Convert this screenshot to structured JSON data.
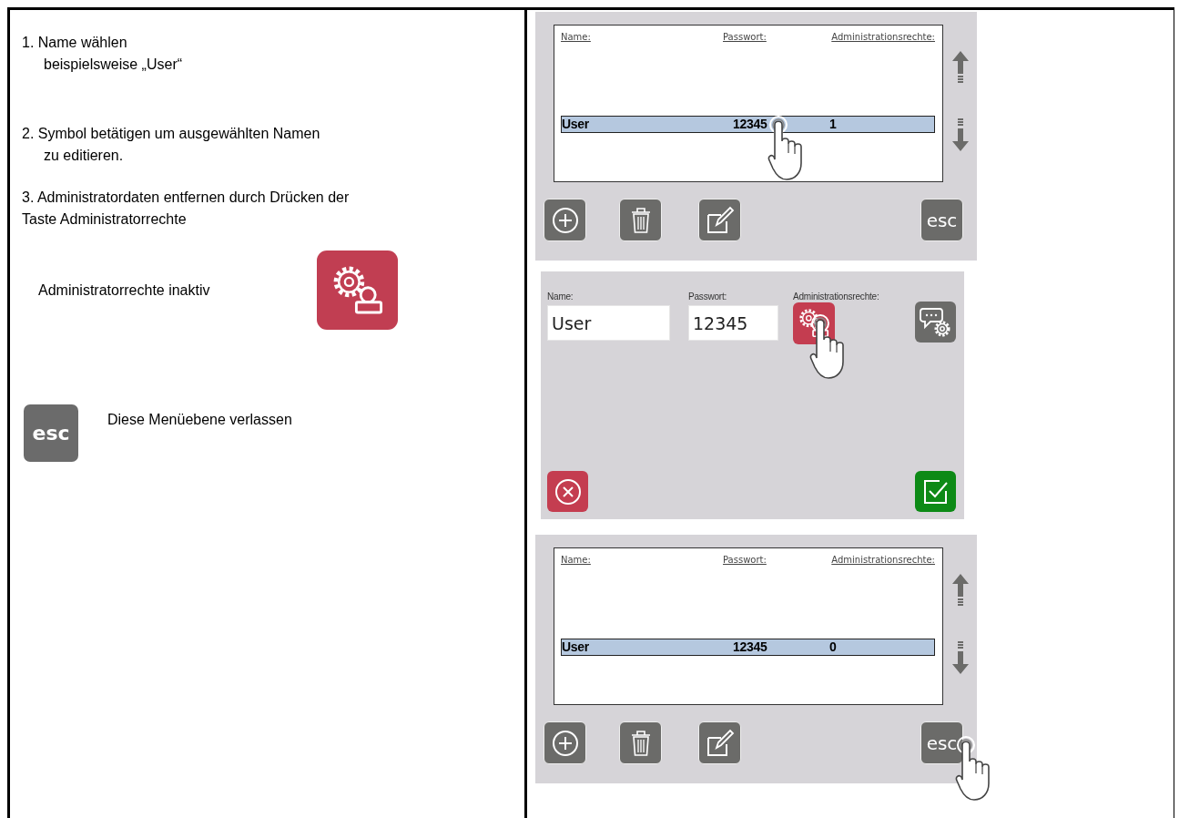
{
  "steps": [
    {
      "number": "1.",
      "lines": [
        "Name wählen",
        "beispielsweise „User“"
      ],
      "hanging_indent": true
    },
    {
      "number": "2.",
      "lines": [
        "Symbol betätigen um ausgewählten Namen",
        "zu editieren."
      ],
      "hanging_indent": true
    },
    {
      "number": "3.",
      "lines": [
        "Administratordaten entfernen durch Drücken der",
        "Taste Administratorrechte"
      ],
      "hanging_indent": false
    }
  ],
  "legend": [
    {
      "kind": "admin-icon",
      "text": "Administratorrechte inaktiv"
    },
    {
      "kind": "esc-key",
      "key_label": "esc",
      "text": "Diese Menüebene verlassen"
    }
  ],
  "screens": [
    {
      "kind": "user-list",
      "columns": [
        "Name:",
        "Passwort:",
        "Administrationsrechte:"
      ],
      "rows": [
        {
          "cells": [
            "User",
            "12345",
            "1"
          ],
          "selected": true,
          "touched": true
        }
      ],
      "buttons": [
        {
          "kind": "add",
          "touched": false
        },
        {
          "kind": "delete",
          "touched": false
        },
        {
          "kind": "edit",
          "touched": false
        },
        {
          "kind": "text",
          "label": "esc",
          "touched": false
        }
      ]
    },
    {
      "kind": "user-edit",
      "fields": [
        {
          "label": "Name:",
          "value": "User"
        },
        {
          "label": "Passwort:",
          "value": "12345"
        }
      ],
      "admin": {
        "label": "Administrationsrechte:",
        "active": false,
        "touched": true
      }
    },
    {
      "kind": "user-list",
      "columns": [
        "Name:",
        "Passwort:",
        "Administrationsrechte:"
      ],
      "rows": [
        {
          "cells": [
            "User",
            "12345",
            "0"
          ],
          "selected": true,
          "touched": false
        }
      ],
      "buttons": [
        {
          "kind": "add",
          "touched": false
        },
        {
          "kind": "delete",
          "touched": false
        },
        {
          "kind": "edit",
          "touched": false
        },
        {
          "kind": "text",
          "label": "esc",
          "touched": true
        }
      ]
    }
  ]
}
